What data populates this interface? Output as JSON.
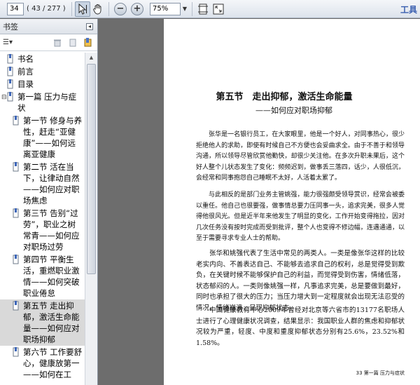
{
  "toolbar": {
    "page_value": "34",
    "page_count": "( 43 / 277 )",
    "zoom_value": "75%",
    "tools_label": "工具"
  },
  "sidebar": {
    "header_title": "书签",
    "items": [
      {
        "label": "书名",
        "level": 0,
        "toggle": ""
      },
      {
        "label": "前言",
        "level": 0,
        "toggle": ""
      },
      {
        "label": "目录",
        "level": 0,
        "toggle": ""
      },
      {
        "label": "第一篇  压力与症状",
        "level": 0,
        "toggle": "⊟"
      },
      {
        "label": "第一节  修身与养性，赶走“亚健康”——如何远离亚健康",
        "level": 1,
        "toggle": ""
      },
      {
        "label": "第二节  活在当下，让律动自然——如何应对职场焦虑",
        "level": 1,
        "toggle": ""
      },
      {
        "label": "第三节  告别“过劳”，职业之树常青——如何应对职场过劳",
        "level": 1,
        "toggle": ""
      },
      {
        "label": "第四节  平衡生活，重燃职业激情——如何突破职业倦怠",
        "level": 1,
        "toggle": ""
      },
      {
        "label": "第五节  走出抑郁，激活生命能量——如何应对职场抑郁",
        "level": 1,
        "toggle": "",
        "selected": true
      },
      {
        "label": "第六节  工作要舒心，健康放第一——如何在工",
        "level": 1,
        "toggle": ""
      }
    ]
  },
  "document": {
    "title": "第五节　走出抑郁，激活生命能量",
    "subtitle": "——如何应对职场抑郁",
    "paragraphs": [
      "张华是一名银行员工，在大家眼里，他是一个好人，对同事热心，很少拒绝他人的求助，即使有时候自己不方便也会妥曲求全。由于不善于和领导沟通，所以领导尽管欣赏他勤快，却很少关注他。在多次升职未果后，这个好人整个儿状态发生了变化：频频迟到，做事丢三落四，话少，人很低沉，会经常和同事抱怨自己睡眠不太好，人活着太累了。",
      "与此相反的是部门业务主管姚强，能力很强颇受领导赏识，经常会被委以重任。他自己也很要强，做事情总要力压同事一头，追求完美，很多人觉得他很风光。但是近半年来他发生了明显的变化，工作开始变得拖拉，因对几次任务没有按时完成而受到批评，整个人也变得不修边幅，连遇通通，以至于需要寻求专业人士的帮助。",
      "张华和姚强代表了生活中常见的两类人。一类是像张华这样的比较老实内向、不善表达自己、不能够去追求自己的权利，总是觉得受到欺负，在关键时候不能够保护自己的利益，而觉得受到伤害，情绪低落，状态郁闷的人。一类则像姚强一样，凡事追求完美，总是要做到最好，同时也承担了很大的压力；当压力增大到一定程度就会出现无法忍受的情况，情绪崩溃，呈现抑郁状态。",
      "中国健康教育中心2009年曾经对北京等六省市的13177名职场人士进行了心理健康状况调查，结果显示：我国职业人群的焦虑和抑郁状况较为严重，轻度、中度和重度抑郁状态分别有25.6%，23.52%和1.58%。"
    ],
    "footer": "33  第一篇  压力与症状"
  }
}
